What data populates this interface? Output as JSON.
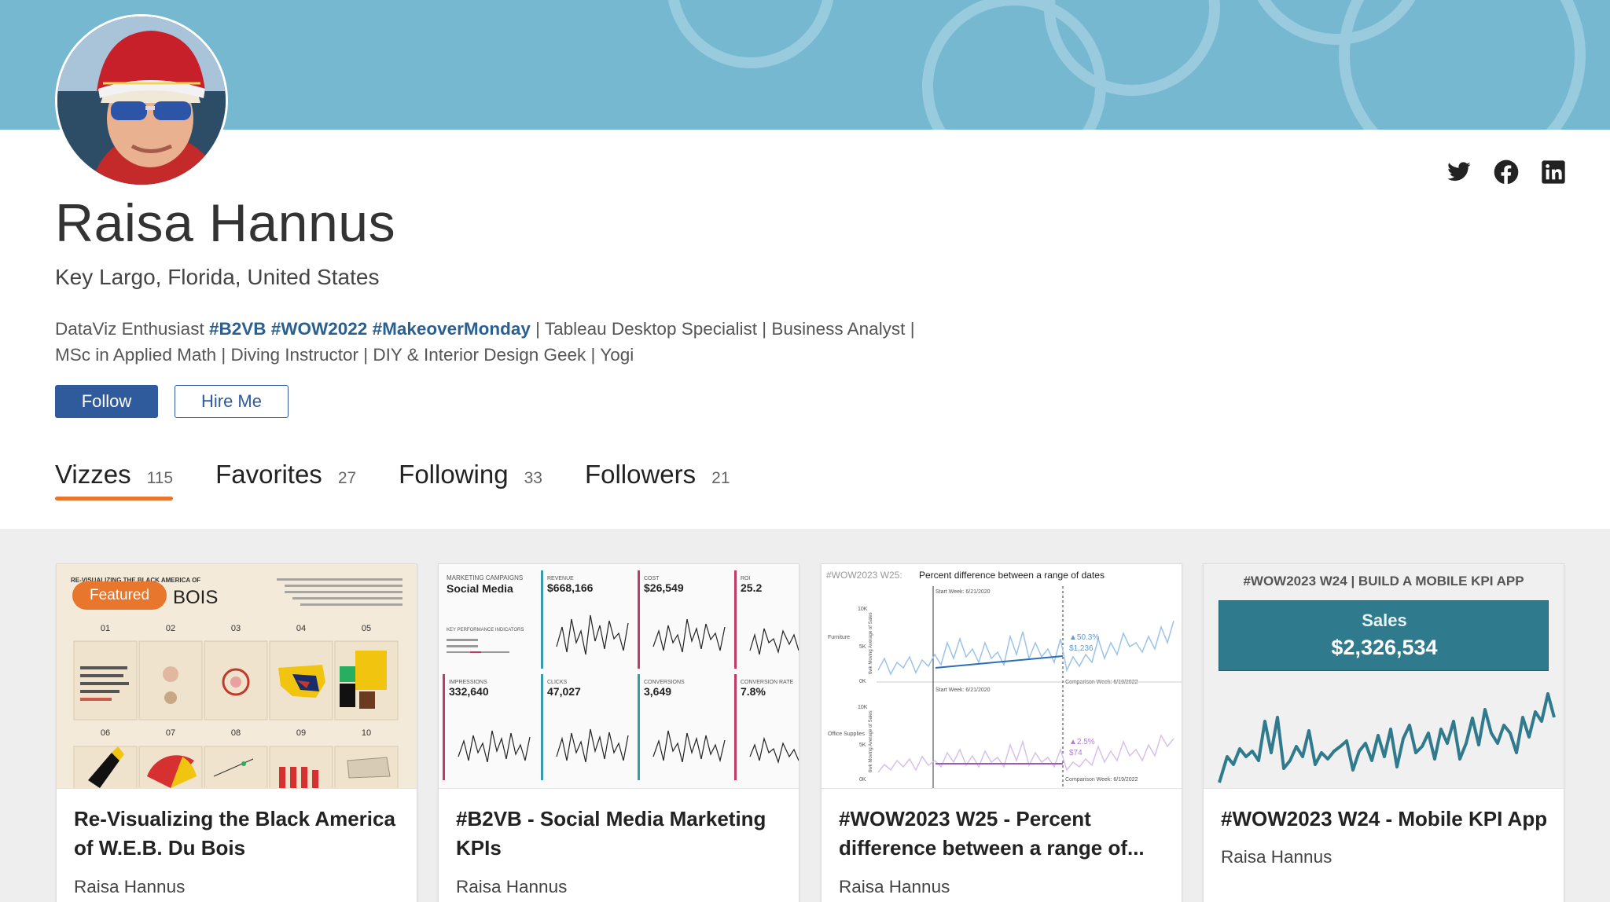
{
  "profile": {
    "name": "Raisa Hannus",
    "location": "Key Largo, Florida, United States",
    "bio_line1_prefix": "DataViz Enthusiast ",
    "bio_tags": [
      "#B2VB",
      "#WOW2022",
      "#MakeoverMonday"
    ],
    "bio_line1_suffix": " | Tableau Desktop Specialist | Business Analyst |",
    "bio_line2": "MSc in Applied Math | Diving Instructor | DIY & Interior Design Geek | Yogi"
  },
  "actions": {
    "follow_label": "Follow",
    "hire_label": "Hire Me"
  },
  "social": [
    "twitter-icon",
    "facebook-icon",
    "linkedin-icon"
  ],
  "tabs": [
    {
      "label": "Vizzes",
      "count": "115"
    },
    {
      "label": "Favorites",
      "count": "27"
    },
    {
      "label": "Following",
      "count": "33"
    },
    {
      "label": "Followers",
      "count": "21"
    }
  ],
  "colors": {
    "banner": "#76b8cf",
    "primary": "#2f5a9c",
    "accent": "#e8762d",
    "link": "#2a5f91",
    "kpi_teal": "#2f7a8c"
  },
  "cards": [
    {
      "title": "Re-Visualizing the Black America of W.E.B. Du Bois",
      "author": "Raisa Hannus",
      "badge": "Featured",
      "thumb": {
        "heading": "RE-VISUALIZING THE BLACK AMERICA OF",
        "heading2": "BOIS",
        "plates_top": [
          "01",
          "02",
          "03",
          "04",
          "05"
        ],
        "plates_bottom": [
          "06",
          "07",
          "08",
          "09",
          "10"
        ]
      }
    },
    {
      "title": "#B2VB - Social Media Marketing KPIs",
      "author": "Raisa Hannus",
      "thumb": {
        "campaign_label": "MARKETING CAMPAIGNS",
        "campaign_title": "Social Media",
        "kpi_heading": "KEY PERFORMANCE INDICATORS",
        "kpis": [
          {
            "label": "REVENUE",
            "value": "$668,166"
          },
          {
            "label": "COST",
            "value": "$26,549"
          },
          {
            "label": "ROI",
            "value": "25.2"
          },
          {
            "label": "IMPRESSIONS",
            "value": "332,640"
          },
          {
            "label": "CLICKS",
            "value": "47,027"
          },
          {
            "label": "CONVERSIONS",
            "value": "3,649"
          },
          {
            "label": "CONVERSION RATE",
            "value": "7.8%"
          }
        ]
      }
    },
    {
      "title": "#WOW2023 W25 - Percent difference between a range of...",
      "author": "Raisa Hannus",
      "thumb": {
        "header_prefix": "#WOW2023 W25:",
        "header_text": "Percent difference between a range of dates",
        "start_label": "Start Week: 6/21/2020",
        "comparison_label": "Comparison Week: 6/19/2022",
        "row1_label": "Furniture",
        "row2_label": "Office Supplies",
        "axis_label": "6wk Moving Average of Sales",
        "row1_pct": "▲50.3%",
        "row1_val": "$1,236",
        "row2_pct": "▲2.5%",
        "row2_val": "$74",
        "ticks": [
          "10K",
          "5K",
          "0K"
        ]
      }
    },
    {
      "title": "#WOW2023 W24 - Mobile KPI App",
      "author": "Raisa Hannus",
      "thumb": {
        "header": "#WOW2023 W24 | BUILD A MOBILE KPI APP",
        "kpi_label": "Sales",
        "kpi_value": "$2,326,534"
      }
    }
  ]
}
